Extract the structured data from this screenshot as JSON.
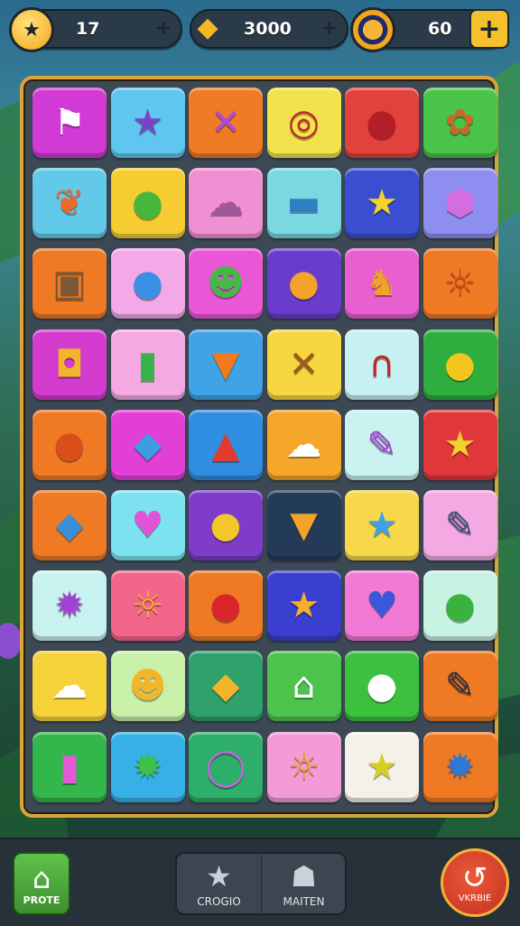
{
  "topbar": {
    "stat1": {
      "value": "17",
      "icon": "star-badge-icon",
      "plus": "+"
    },
    "stat2": {
      "value": "3000",
      "icon": "gem-icon",
      "plus": "+"
    },
    "stat3": {
      "value": "60",
      "icon": "target-icon",
      "plus": "+"
    }
  },
  "board": {
    "rows": [
      [
        {
          "icon": "flag-icon",
          "glyph": "⚑",
          "bg": "#d23ad6",
          "fg": "#ffffff"
        },
        {
          "icon": "star-icon",
          "glyph": "★",
          "bg": "#5fc6ef",
          "fg": "#7a43c7"
        },
        {
          "icon": "crossed-swords-icon",
          "glyph": "✕",
          "bg": "#ef7b25",
          "fg": "#b14ad9"
        },
        {
          "icon": "target-icon",
          "glyph": "◎",
          "bg": "#f2e34d",
          "fg": "#c5262d"
        },
        {
          "icon": "balloon-icon",
          "glyph": "●",
          "bg": "#e2413c",
          "fg": "#b31f28"
        },
        {
          "icon": "flower-icon",
          "glyph": "✿",
          "bg": "#49c34a",
          "fg": "#c56a2a"
        }
      ],
      [
        {
          "icon": "leaf-icon",
          "glyph": "❦",
          "bg": "#62c9e8",
          "fg": "#ef6a2a"
        },
        {
          "icon": "magnifier-icon",
          "glyph": "●",
          "bg": "#f5cc32",
          "fg": "#45b83c"
        },
        {
          "icon": "cake-icon",
          "glyph": "☁",
          "bg": "#f08fd2",
          "fg": "#a0589a"
        },
        {
          "icon": "flag-banner-icon",
          "glyph": "▬",
          "bg": "#79d8e2",
          "fg": "#2f80c3"
        },
        {
          "icon": "star-icon",
          "glyph": "★",
          "bg": "#3a4fd0",
          "fg": "#f5d22a"
        },
        {
          "icon": "cube-icon",
          "glyph": "⬢",
          "bg": "#8e8ef0",
          "fg": "#d46ee0"
        }
      ],
      [
        {
          "icon": "robot-icon",
          "glyph": "▣",
          "bg": "#f07a24",
          "fg": "#7a5a3a"
        },
        {
          "icon": "magnifier-icon",
          "glyph": "●",
          "bg": "#f3a8e8",
          "fg": "#3a8fe6"
        },
        {
          "icon": "cat-icon",
          "glyph": "☻",
          "bg": "#e957d6",
          "fg": "#46b84a"
        },
        {
          "icon": "balloon-icon",
          "glyph": "●",
          "bg": "#6a3ccc",
          "fg": "#f2a42a"
        },
        {
          "icon": "fox-icon",
          "glyph": "♞",
          "bg": "#e85fd0",
          "fg": "#f0a22c"
        },
        {
          "icon": "sun-icon",
          "glyph": "☼",
          "bg": "#f07a24",
          "fg": "#d94c1f"
        }
      ],
      [
        {
          "icon": "square-target-icon",
          "glyph": "◘",
          "bg": "#d33ccf",
          "fg": "#f2b52b"
        },
        {
          "icon": "popsicle-icon",
          "glyph": "▮",
          "bg": "#f4a9e2",
          "fg": "#3ab24b"
        },
        {
          "icon": "carrot-icon",
          "glyph": "▼",
          "bg": "#3fa3e6",
          "fg": "#f07a1e"
        },
        {
          "icon": "crossed-swords-icon",
          "glyph": "✕",
          "bg": "#f6d742",
          "fg": "#9a5a1c"
        },
        {
          "icon": "car-icon",
          "glyph": "∩",
          "bg": "#c7f0f0",
          "fg": "#c2262d"
        },
        {
          "icon": "lemon-icon",
          "glyph": "●",
          "bg": "#2fae3f",
          "fg": "#f3c61f"
        }
      ],
      [
        {
          "icon": "cookie-icon",
          "glyph": "●",
          "bg": "#f07a24",
          "fg": "#d84f1c"
        },
        {
          "icon": "fish-icon",
          "glyph": "◆",
          "bg": "#e13fd6",
          "fg": "#3a9ee0"
        },
        {
          "icon": "kite-icon",
          "glyph": "▲",
          "bg": "#2f8ee0",
          "fg": "#e33a30"
        },
        {
          "icon": "rocket-icon",
          "glyph": "☁",
          "bg": "#f6a629",
          "fg": "#ffffff"
        },
        {
          "icon": "pen-icon",
          "glyph": "✎",
          "bg": "#c9f2f0",
          "fg": "#a23ed2"
        },
        {
          "icon": "star-shield-icon",
          "glyph": "★",
          "bg": "#e0383a",
          "fg": "#f4d22e"
        }
      ],
      [
        {
          "icon": "fish-icon",
          "glyph": "◆",
          "bg": "#f07a24",
          "fg": "#3a8fd8"
        },
        {
          "icon": "heart-icon",
          "glyph": "♥",
          "bg": "#7de2ef",
          "fg": "#e153d6"
        },
        {
          "icon": "apple-icon",
          "glyph": "●",
          "bg": "#7e3cc9",
          "fg": "#f3c62a"
        },
        {
          "icon": "carrot-icon",
          "glyph": "▼",
          "bg": "#243b58",
          "fg": "#f3a22a"
        },
        {
          "icon": "star-icon",
          "glyph": "★",
          "bg": "#f6d84a",
          "fg": "#3ea2e8"
        },
        {
          "icon": "pencil-icon",
          "glyph": "✎",
          "bg": "#f4a9e2",
          "fg": "#3a4a7a"
        }
      ],
      [
        {
          "icon": "sun-icon",
          "glyph": "✹",
          "bg": "#c8f2f0",
          "fg": "#a044d4"
        },
        {
          "icon": "sun-icon",
          "glyph": "☼",
          "bg": "#f2668b",
          "fg": "#f6b22a"
        },
        {
          "icon": "balloon-icon",
          "glyph": "●",
          "bg": "#f07a24",
          "fg": "#d9262d"
        },
        {
          "icon": "star-icon",
          "glyph": "★",
          "bg": "#3a3fcf",
          "fg": "#f3b02a"
        },
        {
          "icon": "heart-icon",
          "glyph": "♥",
          "bg": "#f07ad4",
          "fg": "#3a58d9"
        },
        {
          "icon": "magnifier-icon",
          "glyph": "●",
          "bg": "#c8f2e2",
          "fg": "#3ab23f"
        }
      ],
      [
        {
          "icon": "rocket-icon",
          "glyph": "☁",
          "bg": "#f6d23a",
          "fg": "#ffffff"
        },
        {
          "icon": "smiley-icon",
          "glyph": "☻",
          "bg": "#c8f0a8",
          "fg": "#f3b52a"
        },
        {
          "icon": "diamond-icon",
          "glyph": "◆",
          "bg": "#2ea26a",
          "fg": "#f2b42a"
        },
        {
          "icon": "house-icon",
          "glyph": "⌂",
          "bg": "#4cc34d",
          "fg": "#ffffff"
        },
        {
          "icon": "speech-bubble-icon",
          "glyph": "●",
          "bg": "#3cc13e",
          "fg": "#ffffff"
        },
        {
          "icon": "pencil-icon",
          "glyph": "✎",
          "bg": "#f07a24",
          "fg": "#2a3040"
        }
      ],
      [
        {
          "icon": "popsicle-icon",
          "glyph": "▮",
          "bg": "#33b64a",
          "fg": "#e45ad6"
        },
        {
          "icon": "sun-icon",
          "glyph": "✹",
          "bg": "#36b0e6",
          "fg": "#3fc14b"
        },
        {
          "icon": "magnifier-icon",
          "glyph": "◯",
          "bg": "#2eae6b",
          "fg": "#c763e0"
        },
        {
          "icon": "sun-icon",
          "glyph": "☼",
          "bg": "#f39ad8",
          "fg": "#f3a32a"
        },
        {
          "icon": "star-icon",
          "glyph": "★",
          "bg": "#f4f0ea",
          "fg": "#d7cf22"
        },
        {
          "icon": "gear-icon",
          "glyph": "✹",
          "bg": "#f07a24",
          "fg": "#2f78d8"
        }
      ]
    ]
  },
  "bottombar": {
    "home_label": "PROTE",
    "star_label": "CROGIO",
    "map_label": "MAITEN",
    "refresh_label": "VKRBIE"
  }
}
